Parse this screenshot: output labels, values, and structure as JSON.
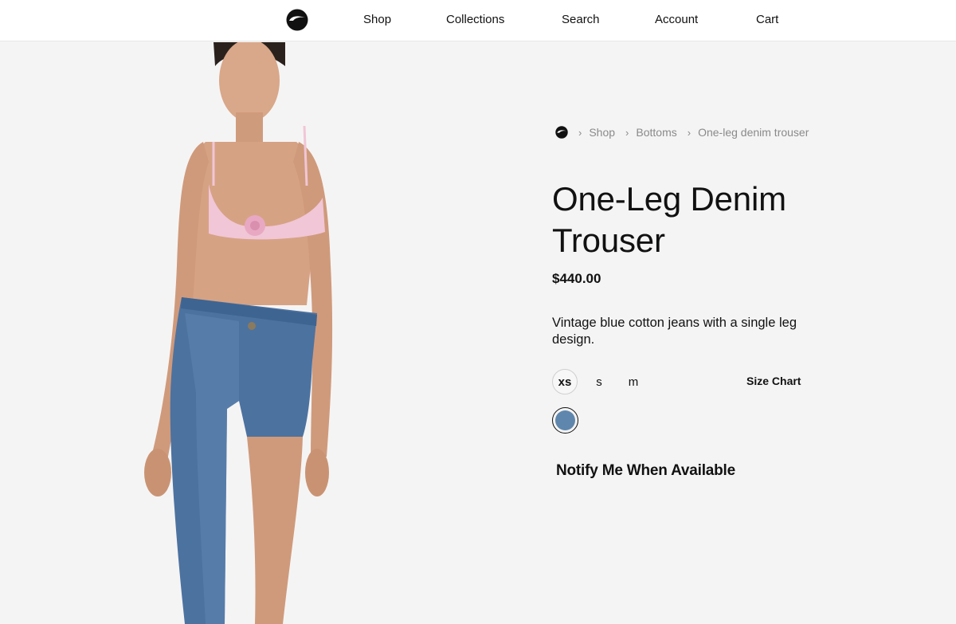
{
  "header": {
    "logo": "brand-logo-icon",
    "nav": [
      "Shop",
      "Collections",
      "Search",
      "Account",
      "Cart"
    ]
  },
  "breadcrumb": {
    "home_icon": "brand-logo-icon",
    "items": [
      "Shop",
      "Bottoms",
      "One-leg denim trouser"
    ],
    "separator": "›"
  },
  "product": {
    "title": "One-Leg Denim Trouser",
    "price": "$440.00",
    "description": "Vintage blue cotton jeans with a single leg design.",
    "sizes": [
      "xs",
      "s",
      "m"
    ],
    "selected_size": "xs",
    "size_chart_label": "Size Chart",
    "swatch_color": "#5f87ad",
    "notify_label": "Notify Me When Available"
  },
  "colors": {
    "background": "#f5f4f4",
    "header_bg": "#ffffff",
    "text": "#111111",
    "muted": "#8a8a8a"
  }
}
